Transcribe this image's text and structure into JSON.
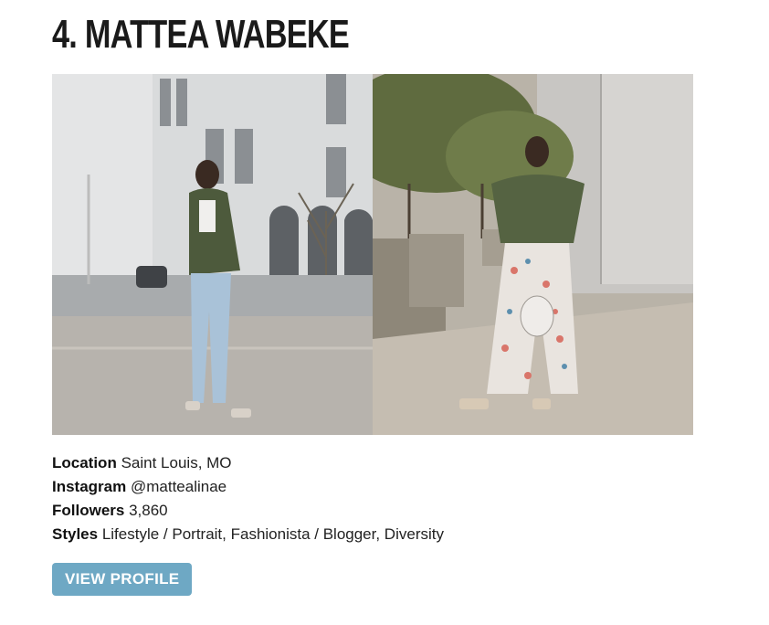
{
  "profile": {
    "title": "4. MATTEA WABEKE",
    "details": {
      "location_label": "Location",
      "location_value": "Saint Louis, MO",
      "instagram_label": "Instagram",
      "instagram_value": "@mattealinae",
      "followers_label": "Followers",
      "followers_value": "3,860",
      "styles_label": "Styles",
      "styles_value": "Lifestyle / Portrait, Fashionista / Blogger, Diversity"
    },
    "button_label": "VIEW PROFILE"
  },
  "colors": {
    "button_bg": "#6ea8c4",
    "title": "#1a1a1a"
  }
}
